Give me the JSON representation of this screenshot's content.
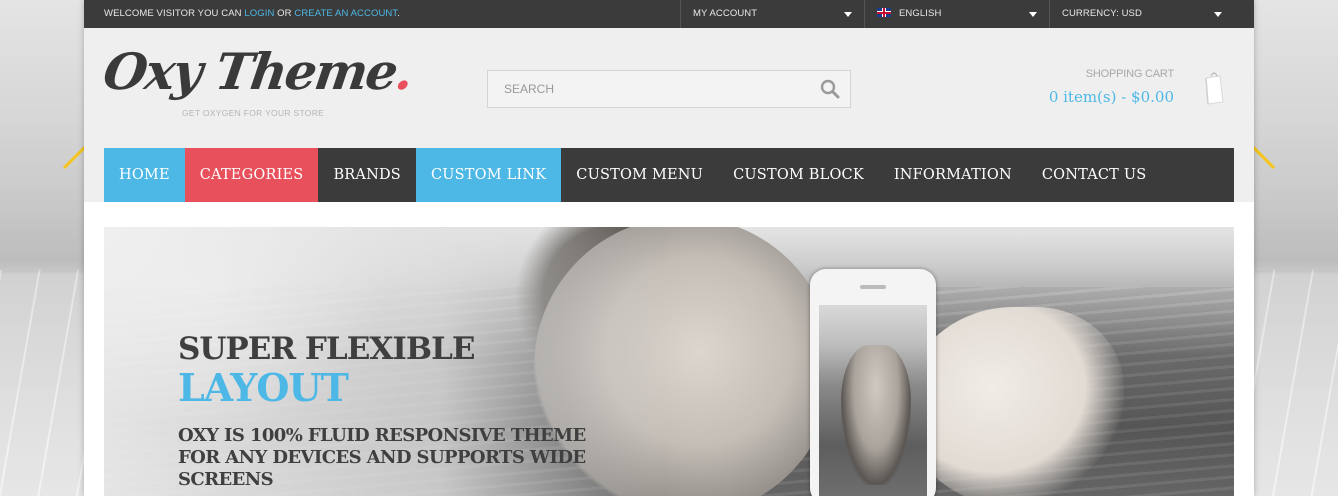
{
  "topbar": {
    "welcome_prefix": "WELCOME VISITOR YOU CAN ",
    "login_link": "LOGIN",
    "welcome_or": " OR ",
    "create_account_link": "CREATE AN ACCOUNT",
    "welcome_suffix": ".",
    "account_label": "MY ACCOUNT",
    "language_label": "ENGLISH",
    "currency_label": "CURRENCY: USD"
  },
  "header": {
    "logo_text": "Oxy Theme",
    "logo_dot": ".",
    "tagline": "GET OXYGEN FOR YOUR STORE",
    "search_placeholder": "SEARCH",
    "cart_label": "SHOPPING CART",
    "cart_total": "0 item(s) - $0.00"
  },
  "nav": {
    "items": [
      {
        "label": "HOME"
      },
      {
        "label": "CATEGORIES"
      },
      {
        "label": "BRANDS"
      },
      {
        "label": "CUSTOM LINK"
      },
      {
        "label": "CUSTOM MENU"
      },
      {
        "label": "CUSTOM BLOCK"
      },
      {
        "label": "INFORMATION"
      },
      {
        "label": "CONTACT US"
      }
    ]
  },
  "banner": {
    "title_line1": "SUPER FLEXIBLE",
    "title_line2": "LAYOUT",
    "description": "OXY IS 100% FLUID RESPONSIVE THEME FOR ANY DEVICES AND SUPPORTS WIDE SCREENS"
  },
  "colors": {
    "accent_blue": "#4db8e6",
    "accent_red": "#e8505b",
    "dark_bar": "#3b3b3b",
    "arrow_yellow": "#f5c518"
  },
  "icons": {
    "search": "search-icon",
    "cart": "shopping-bag-icon",
    "caret": "caret-down-icon",
    "flag": "uk-flag-icon",
    "arrow": "arrow-icon"
  }
}
